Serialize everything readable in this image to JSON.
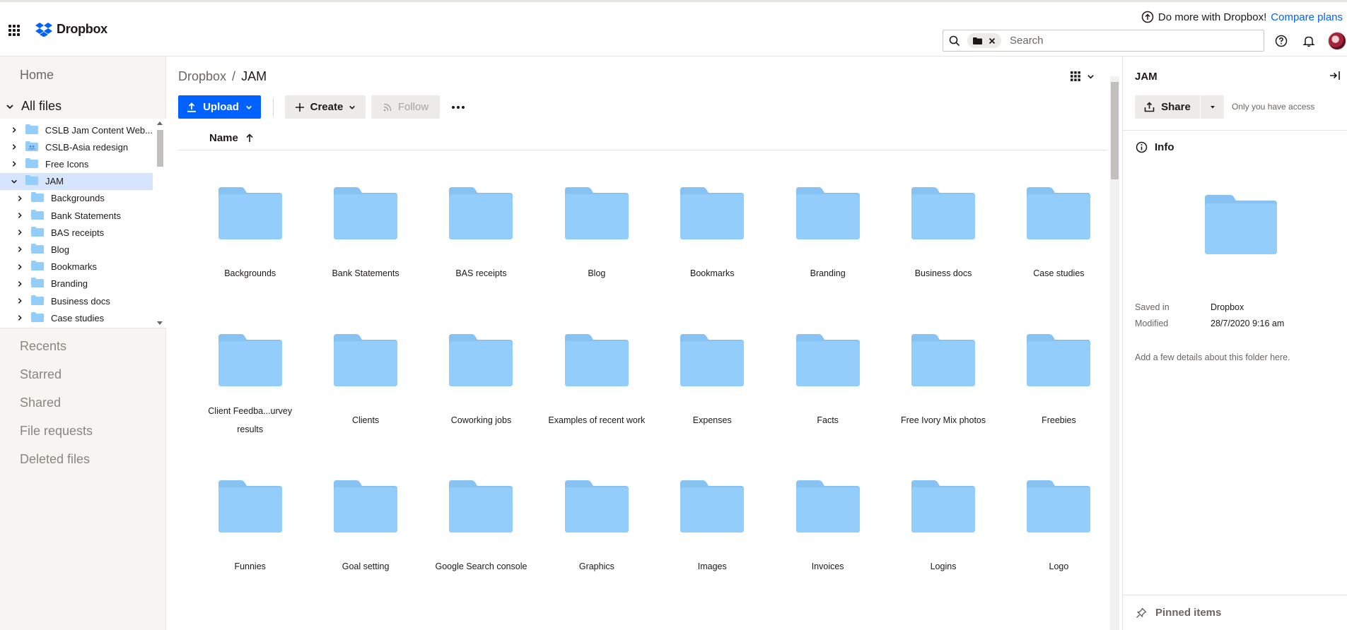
{
  "header": {
    "logo_text": "Dropbox",
    "promo_text": "Do more with Dropbox!",
    "promo_link": "Compare plans",
    "search_placeholder": "Search"
  },
  "sidebar": {
    "home": "Home",
    "all_files": "All files",
    "tree": [
      {
        "label": "CSLB Jam Content Web...",
        "level": 0,
        "selected": false,
        "shared": false
      },
      {
        "label": "CSLB-Asia redesign",
        "level": 0,
        "selected": false,
        "shared": true
      },
      {
        "label": "Free Icons",
        "level": 0,
        "selected": false,
        "shared": false
      },
      {
        "label": "JAM",
        "level": 0,
        "selected": true,
        "shared": false,
        "expanded": true
      },
      {
        "label": "Backgrounds",
        "level": 1,
        "selected": false,
        "shared": false
      },
      {
        "label": "Bank Statements",
        "level": 1,
        "selected": false,
        "shared": false
      },
      {
        "label": "BAS receipts",
        "level": 1,
        "selected": false,
        "shared": false
      },
      {
        "label": "Blog",
        "level": 1,
        "selected": false,
        "shared": false
      },
      {
        "label": "Bookmarks",
        "level": 1,
        "selected": false,
        "shared": false
      },
      {
        "label": "Branding",
        "level": 1,
        "selected": false,
        "shared": false
      },
      {
        "label": "Business docs",
        "level": 1,
        "selected": false,
        "shared": false
      },
      {
        "label": "Case studies",
        "level": 1,
        "selected": false,
        "shared": false
      }
    ],
    "nav": [
      "Recents",
      "Starred",
      "Shared",
      "File requests",
      "Deleted files"
    ]
  },
  "main": {
    "breadcrumb_root": "Dropbox",
    "breadcrumb_sep": "/",
    "breadcrumb_current": "JAM",
    "upload_label": "Upload",
    "create_label": "Create",
    "follow_label": "Follow",
    "column_name": "Name",
    "folders": [
      "Backgrounds",
      "Bank Statements",
      "BAS receipts",
      "Blog",
      "Bookmarks",
      "Branding",
      "Business docs",
      "Case studies",
      "Client Feedba...urvey results",
      "Clients",
      "Coworking jobs",
      "Examples of recent work",
      "Expenses",
      "Facts",
      "Free Ivory Mix photos",
      "Freebies",
      "Funnies",
      "Goal setting",
      "Google Search console",
      "Graphics",
      "Images",
      "Invoices",
      "Logins",
      "Logo"
    ]
  },
  "panel": {
    "title": "JAM",
    "share_label": "Share",
    "access": "Only you have access",
    "info_label": "Info",
    "saved_in_label": "Saved in",
    "saved_in_value": "Dropbox",
    "modified_label": "Modified",
    "modified_value": "28/7/2020 9:16 am",
    "description_hint": "Add a few details about this folder here.",
    "pinned_label": "Pinned items"
  },
  "colors": {
    "accent": "#0061fe",
    "folder": "#92cdfb",
    "folder_tab": "#87c2f3",
    "selected_row": "#d6e4fd"
  }
}
